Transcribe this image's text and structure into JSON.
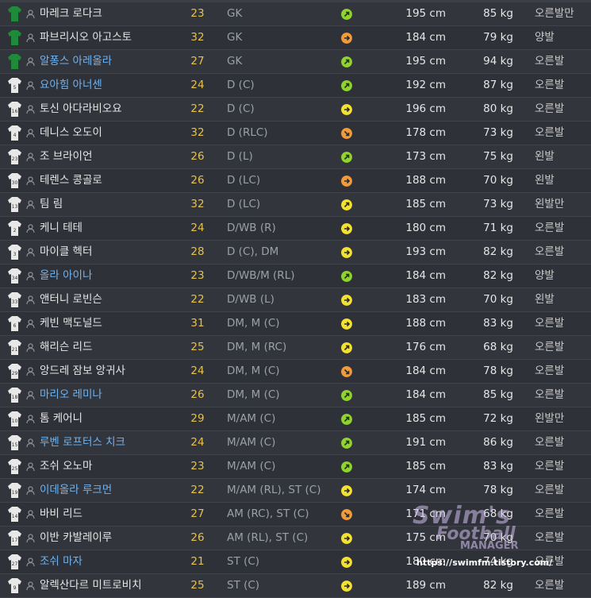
{
  "colors": {
    "row_odd": "#33353c",
    "row_even": "#2f3138",
    "age": "#e7c24a",
    "loan_name": "#6fb3f0",
    "keeper_shirt": "#1f8a3a",
    "outfield_shirt": "#e8e8e8",
    "condition_green": "#8fd32c",
    "condition_yellow": "#f2e12f",
    "condition_orange": "#f09a3a"
  },
  "players": [
    {
      "num": "",
      "name": "마레크 로다크",
      "age": "23",
      "pos": "GK",
      "height": "195 cm",
      "weight": "85 kg",
      "foot": "오른발만",
      "shirt": "keeper",
      "loan": false,
      "cond": "green",
      "arrow": "up"
    },
    {
      "num": "",
      "name": "파브리시오 아고스토",
      "age": "32",
      "pos": "GK",
      "height": "184 cm",
      "weight": "79 kg",
      "foot": "양발",
      "shirt": "keeper",
      "loan": false,
      "cond": "orange",
      "arrow": "right"
    },
    {
      "num": "",
      "name": "알퐁스 아레올라",
      "age": "27",
      "pos": "GK",
      "height": "195 cm",
      "weight": "94 kg",
      "foot": "오른발",
      "shirt": "keeper",
      "loan": true,
      "cond": "green",
      "arrow": "up"
    },
    {
      "num": "5",
      "name": "요아힘 아너센",
      "age": "24",
      "pos": "D (C)",
      "height": "192 cm",
      "weight": "87 kg",
      "foot": "오른발",
      "shirt": "outfield",
      "loan": true,
      "cond": "green",
      "arrow": "up"
    },
    {
      "num": "16",
      "name": "토신 아다라비오요",
      "age": "22",
      "pos": "D (C)",
      "height": "196 cm",
      "weight": "80 kg",
      "foot": "오른발",
      "shirt": "outfield",
      "loan": false,
      "cond": "yellow",
      "arrow": "right"
    },
    {
      "num": "4",
      "name": "데니스 오도이",
      "age": "32",
      "pos": "D (RLC)",
      "height": "178 cm",
      "weight": "73 kg",
      "foot": "오른발",
      "shirt": "outfield",
      "loan": false,
      "cond": "orange",
      "arrow": "down"
    },
    {
      "num": "23",
      "name": "조 브라이언",
      "age": "26",
      "pos": "D (L)",
      "height": "173 cm",
      "weight": "75 kg",
      "foot": "왼발",
      "shirt": "outfield",
      "loan": false,
      "cond": "green",
      "arrow": "up"
    },
    {
      "num": "30",
      "name": "테렌스 콩골로",
      "age": "26",
      "pos": "D (LC)",
      "height": "188 cm",
      "weight": "70 kg",
      "foot": "왼발",
      "shirt": "outfield",
      "loan": false,
      "cond": "orange",
      "arrow": "right"
    },
    {
      "num": "13",
      "name": "팀 림",
      "age": "32",
      "pos": "D (LC)",
      "height": "185 cm",
      "weight": "73 kg",
      "foot": "왼발만",
      "shirt": "outfield",
      "loan": false,
      "cond": "yellow",
      "arrow": "up"
    },
    {
      "num": "2",
      "name": "케니 테테",
      "age": "24",
      "pos": "D/WB (R)",
      "height": "180 cm",
      "weight": "71 kg",
      "foot": "오른발",
      "shirt": "outfield",
      "loan": false,
      "cond": "yellow",
      "arrow": "right"
    },
    {
      "num": "3",
      "name": "마이클 헥터",
      "age": "28",
      "pos": "D (C), DM",
      "height": "193 cm",
      "weight": "82 kg",
      "foot": "오른발",
      "shirt": "outfield",
      "loan": false,
      "cond": "yellow",
      "arrow": "right"
    },
    {
      "num": "34",
      "name": "올라 아이나",
      "age": "23",
      "pos": "D/WB/M (RL)",
      "height": "184 cm",
      "weight": "82 kg",
      "foot": "양발",
      "shirt": "outfield",
      "loan": true,
      "cond": "green",
      "arrow": "up"
    },
    {
      "num": "33",
      "name": "앤터니 로빈슨",
      "age": "22",
      "pos": "D/WB (L)",
      "height": "183 cm",
      "weight": "70 kg",
      "foot": "왼발",
      "shirt": "outfield",
      "loan": false,
      "cond": "yellow",
      "arrow": "right"
    },
    {
      "num": "6",
      "name": "케빈 맥도널드",
      "age": "31",
      "pos": "DM, M (C)",
      "height": "188 cm",
      "weight": "83 kg",
      "foot": "오른발",
      "shirt": "outfield",
      "loan": false,
      "cond": "yellow",
      "arrow": "right"
    },
    {
      "num": "21",
      "name": "해리슨 리드",
      "age": "25",
      "pos": "DM, M (RC)",
      "height": "176 cm",
      "weight": "68 kg",
      "foot": "오른발",
      "shirt": "outfield",
      "loan": false,
      "cond": "yellow",
      "arrow": "up"
    },
    {
      "num": "29",
      "name": "앙드레 잠보 앙귀사",
      "age": "24",
      "pos": "DM, M (C)",
      "height": "184 cm",
      "weight": "78 kg",
      "foot": "오른발",
      "shirt": "outfield",
      "loan": false,
      "cond": "orange",
      "arrow": "down"
    },
    {
      "num": "18",
      "name": "마리오 레미나",
      "age": "26",
      "pos": "DM, M (C)",
      "height": "184 cm",
      "weight": "85 kg",
      "foot": "오른발",
      "shirt": "outfield",
      "loan": true,
      "cond": "green",
      "arrow": "up"
    },
    {
      "num": "10",
      "name": "톰 케어니",
      "age": "29",
      "pos": "M/AM (C)",
      "height": "185 cm",
      "weight": "72 kg",
      "foot": "왼발만",
      "shirt": "outfield",
      "loan": false,
      "cond": "green",
      "arrow": "up"
    },
    {
      "num": "15",
      "name": "루벤 로프터스 치크",
      "age": "24",
      "pos": "M/AM (C)",
      "height": "191 cm",
      "weight": "86 kg",
      "foot": "오른발",
      "shirt": "outfield",
      "loan": true,
      "cond": "green",
      "arrow": "up"
    },
    {
      "num": "25",
      "name": "조쉬 오노마",
      "age": "23",
      "pos": "M/AM (C)",
      "height": "185 cm",
      "weight": "83 kg",
      "foot": "오른발",
      "shirt": "outfield",
      "loan": false,
      "cond": "green",
      "arrow": "up"
    },
    {
      "num": "19",
      "name": "이데올라 루크먼",
      "age": "22",
      "pos": "M/AM (RL), ST (C)",
      "height": "174 cm",
      "weight": "78 kg",
      "foot": "오른발",
      "shirt": "outfield",
      "loan": true,
      "cond": "yellow",
      "arrow": "right"
    },
    {
      "num": "14",
      "name": "바비 리드",
      "age": "27",
      "pos": "AM (RC), ST (C)",
      "height": "171 cm",
      "weight": "68 kg",
      "foot": "오른발",
      "shirt": "outfield",
      "loan": false,
      "cond": "orange",
      "arrow": "down"
    },
    {
      "num": "17",
      "name": "이반 카발레이루",
      "age": "26",
      "pos": "AM (RL), ST (C)",
      "height": "175 cm",
      "weight": "70 kg",
      "foot": "오른발",
      "shirt": "outfield",
      "loan": false,
      "cond": "yellow",
      "arrow": "right"
    },
    {
      "num": "27",
      "name": "조쉬 마자",
      "age": "21",
      "pos": "ST (C)",
      "height": "180 cm",
      "weight": "74 kg",
      "foot": "오른발",
      "shirt": "outfield",
      "loan": true,
      "cond": "yellow",
      "arrow": "right"
    },
    {
      "num": "9",
      "name": "알렉산다르 미트로비치",
      "age": "25",
      "pos": "ST (C)",
      "height": "189 cm",
      "weight": "82 kg",
      "foot": "오른발",
      "shirt": "outfield",
      "loan": false,
      "cond": "yellow",
      "arrow": "right"
    }
  ],
  "watermark": {
    "line1": "Swim's",
    "line2": "Football",
    "line3": "MANAGER",
    "url": "https://swimfm.tistory.com/"
  }
}
